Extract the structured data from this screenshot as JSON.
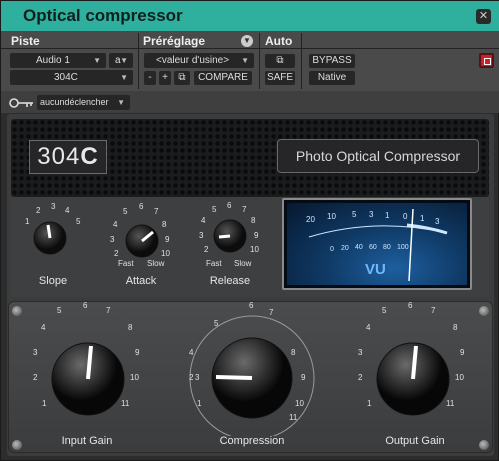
{
  "window": {
    "title": "Optical compressor"
  },
  "header": {
    "piste_label": "Piste",
    "preset_label": "Préréglage",
    "auto_label": "Auto",
    "track_name": "Audio 1",
    "track_channel": "a",
    "insert_name": "304C",
    "preset_value": "<valeur d'usine>",
    "minus": "-",
    "plus": "+",
    "compare": "COMPARE",
    "safe": "SAFE",
    "bypass": "BYPASS",
    "native": "Native"
  },
  "sidechain": {
    "value": "aucundéclencher"
  },
  "plugin": {
    "logo_prefix": "304",
    "logo_suffix": "C",
    "name": "Photo Optical Compressor",
    "slope": {
      "label": "Slope",
      "ticks": [
        "1",
        "2",
        "3",
        "4",
        "5"
      ]
    },
    "attack": {
      "label": "Attack",
      "ticks": [
        "2",
        "3",
        "4",
        "5",
        "6",
        "7",
        "8",
        "9",
        "10"
      ],
      "fast": "Fast",
      "slow": "Slow"
    },
    "release": {
      "label": "Release",
      "ticks": [
        "2",
        "3",
        "4",
        "5",
        "6",
        "7",
        "8",
        "9",
        "10"
      ],
      "fast": "Fast",
      "slow": "Slow"
    },
    "vu": {
      "label": "VU",
      "top_scale": [
        "20",
        "10",
        "5",
        "3",
        "1",
        "0",
        "1",
        "3"
      ],
      "bottom_scale": [
        "0",
        "20",
        "40",
        "60",
        "80",
        "100"
      ]
    },
    "input_gain": {
      "label": "Input Gain",
      "ticks": [
        "1",
        "2",
        "3",
        "4",
        "5",
        "6",
        "7",
        "8",
        "9",
        "10",
        "11"
      ]
    },
    "compression": {
      "label": "Compression",
      "ticks": [
        "1",
        "2",
        "3",
        "4",
        "5",
        "6",
        "7",
        "8",
        "9",
        "10",
        "11"
      ]
    },
    "output_gain": {
      "label": "Output Gain",
      "ticks": [
        "1",
        "2",
        "3",
        "4",
        "5",
        "6",
        "7",
        "8",
        "9",
        "10",
        "11"
      ]
    }
  },
  "colors": {
    "titlebar": "#2fb09e",
    "bypass_active": "#c8232a",
    "vu_blue": "#1d5f9e"
  },
  "icons": {
    "close": "close-icon",
    "copy": "copy-icon",
    "key": "key-icon",
    "power": "power-icon"
  }
}
